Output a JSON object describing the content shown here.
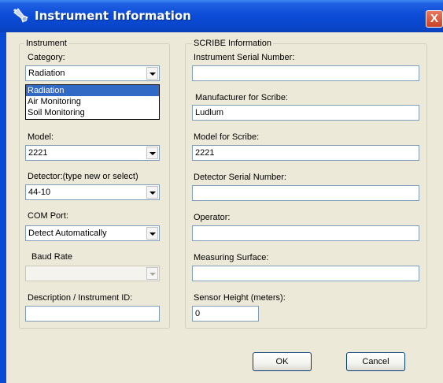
{
  "window": {
    "title": "Instrument Information",
    "close_glyph": "X"
  },
  "instrument": {
    "group_label": "Instrument",
    "category_label": "Category:",
    "category_value": "Radiation",
    "category_options": [
      "Radiation",
      "Air Monitoring",
      "Soil Monitoring"
    ],
    "model_label": "Model:",
    "model_value": "2221",
    "detector_label": "Detector:(type new or select)",
    "detector_value": "44-10",
    "com_port_label": "COM Port:",
    "com_port_value": "Detect Automatically",
    "baud_rate_label": "Baud Rate",
    "baud_rate_value": "",
    "description_label": "Description / Instrument ID:",
    "description_value": ""
  },
  "scribe": {
    "group_label": "SCRIBE Information",
    "serial_label": "Instrument Serial Number:",
    "serial_value": "",
    "manufacturer_label": "Manufacturer for Scribe:",
    "manufacturer_value": "Ludlum",
    "model_label": "Model for Scribe:",
    "model_value": "2221",
    "detector_serial_label": "Detector Serial Number:",
    "detector_serial_value": "",
    "operator_label": "Operator:",
    "operator_value": "",
    "surface_label": "Measuring Surface:",
    "surface_value": "",
    "sensor_height_label": "Sensor Height (meters):",
    "sensor_height_value": "0"
  },
  "buttons": {
    "ok": "OK",
    "cancel": "Cancel"
  },
  "colors": {
    "titlebar": "#0b4bd6",
    "dialog_background": "#ece9d8",
    "selection": "#316ac5"
  }
}
